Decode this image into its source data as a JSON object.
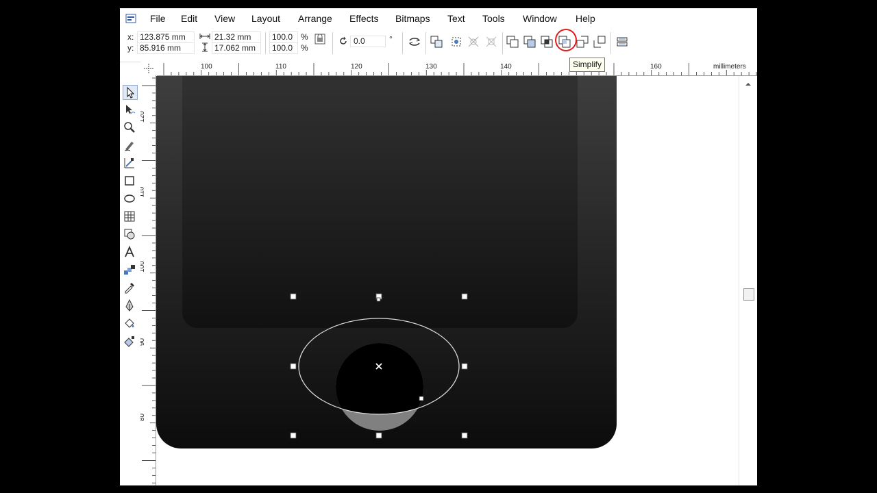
{
  "menu": [
    "File",
    "Edit",
    "View",
    "Layout",
    "Arrange",
    "Effects",
    "Bitmaps",
    "Text",
    "Tools",
    "Window",
    "Help"
  ],
  "property_bar": {
    "x_label": "x:",
    "x_value": "123.875 mm",
    "y_label": "y:",
    "y_value": "85.916 mm",
    "width_value": "21.32 mm",
    "height_value": "17.062 mm",
    "scale_x": "100.0",
    "scale_y": "100.0",
    "percent": "%",
    "rotation": "0.0",
    "degree": "°"
  },
  "tooltip": "Simplify",
  "ruler": {
    "unit": "millimeters",
    "h_labels": [
      "100",
      "110",
      "120",
      "130",
      "140",
      "160"
    ],
    "v_labels": [
      "120",
      "110",
      "100",
      "90",
      "80"
    ]
  },
  "colors": {
    "highlight_circle": "#e11b1b",
    "device_top": "#3e3e3e",
    "device_bottom": "#0c0c0c",
    "screen_top": "#333333",
    "screen_bottom": "#111111",
    "button_lower": "#808080"
  },
  "icons": {
    "toolbox": [
      "pick-tool-icon",
      "shape-tool-icon",
      "zoom-tool-icon",
      "freehand-tool-icon",
      "smart-fill-icon",
      "rectangle-tool-icon",
      "ellipse-tool-icon",
      "graph-paper-icon",
      "basic-shapes-icon",
      "text-tool-icon",
      "interactive-blend-icon",
      "eyedropper-icon",
      "outline-pen-icon",
      "fill-tool-icon",
      "interactive-fill-icon"
    ],
    "property_bar": [
      "lock-ratio-icon",
      "rotate-icon",
      "mirror-icon",
      "group-icon",
      "ungroup-icon",
      "ungroup-all-icon",
      "combine-icon",
      "break-apart-icon",
      "weld-icon",
      "trim-icon",
      "intersect-icon",
      "simplify-icon",
      "front-minus-back-icon",
      "back-minus-front-icon",
      "create-boundary-icon"
    ]
  }
}
